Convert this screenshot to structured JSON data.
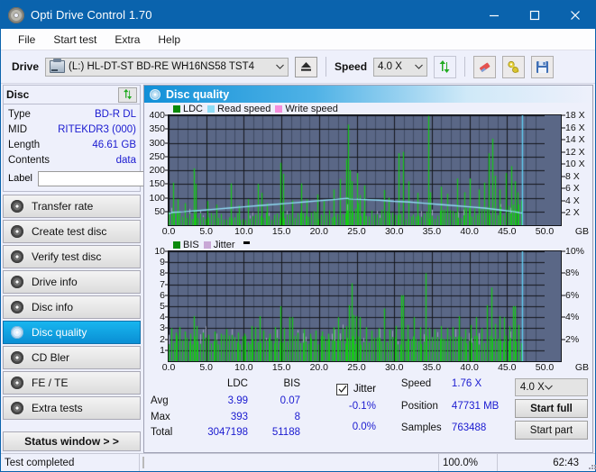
{
  "window": {
    "title": "Opti Drive Control 1.70",
    "icon": "disc-icon",
    "minimize": "minimize-icon",
    "maximize": "maximize-icon",
    "close": "close-icon"
  },
  "menu": {
    "items": [
      {
        "label": "File"
      },
      {
        "label": "Start test"
      },
      {
        "label": "Extra"
      },
      {
        "label": "Help"
      }
    ]
  },
  "toolbar": {
    "drive_label": "Drive",
    "drive_value": "(L:)  HL-DT-ST BD-RE  WH16NS58 TST4",
    "eject": "eject-icon",
    "speed_label": "Speed",
    "speed_value": "4.0 X",
    "refresh": "refresh-icon",
    "erase": "eraser-icon",
    "tools": "tools-icon",
    "save": "save-icon"
  },
  "sidebar": {
    "disc_panel": {
      "title": "Disc",
      "refresh_icon": "refresh-icon",
      "rows": [
        {
          "key": "Type",
          "value": "BD-R DL"
        },
        {
          "key": "MID",
          "value": "RITEKDR3 (000)"
        },
        {
          "key": "Length",
          "value": "46.61 GB"
        },
        {
          "key": "Contents",
          "value": "data"
        }
      ],
      "label_key": "Label",
      "label_value": "",
      "label_placeholder": "",
      "label_button_icon": "disc-icon"
    },
    "nav": [
      {
        "label": "Transfer rate",
        "active": false
      },
      {
        "label": "Create test disc",
        "active": false
      },
      {
        "label": "Verify test disc",
        "active": false
      },
      {
        "label": "Drive info",
        "active": false
      },
      {
        "label": "Disc info",
        "active": false
      },
      {
        "label": "Disc quality",
        "active": true
      },
      {
        "label": "CD Bler",
        "active": false
      },
      {
        "label": "FE / TE",
        "active": false
      },
      {
        "label": "Extra tests",
        "active": false
      }
    ],
    "status_window_button": "Status window > >"
  },
  "main": {
    "header_title": "Disc quality",
    "header_icon": "disc-quality-icon"
  },
  "stats": {
    "columns": [
      "LDC",
      "BIS"
    ],
    "rows": [
      {
        "label": "Avg",
        "ldc": "3.99",
        "bis": "0.07",
        "jitter": "-0.1%"
      },
      {
        "label": "Max",
        "ldc": "393",
        "bis": "8",
        "jitter": "0.0%"
      },
      {
        "label": "Total",
        "ldc": "3047198",
        "bis": "51188",
        "jitter": ""
      }
    ],
    "jitter_label": "Jitter",
    "jitter_checked": true,
    "speed_label": "Speed",
    "speed_value": "1.76 X",
    "position_label": "Position",
    "position_value": "47731 MB",
    "samples_label": "Samples",
    "samples_value": "763488",
    "speed_select": "4.0 X",
    "start_full_button": "Start full",
    "start_part_button": "Start part"
  },
  "statusbar": {
    "message": "Test completed",
    "progress_percent_label": "100.0%",
    "progress_value": 100,
    "elapsed": "62:43"
  },
  "colors": {
    "accent": "#0a63ad",
    "plot_bg": "#5a6786",
    "grid": "#14161c",
    "ldc_green": "#15cc15",
    "read_speed": "#8fdcf5",
    "write_speed": "#f58fdc",
    "bis_green": "#15cc15",
    "jitter": "#c9a8d6",
    "value_blue": "#1a1ad0",
    "progress_green": "#04c004",
    "nav_active": "#12a4e2"
  },
  "chart_data": [
    {
      "type": "line",
      "name": "ldc-read-speed-chart",
      "title": "",
      "xlabel": "GB",
      "ylabel": "LDC",
      "y2label": "Speed (X)",
      "xlim": [
        0,
        50
      ],
      "ylim": [
        0,
        400
      ],
      "y2lim": [
        0,
        18
      ],
      "grid": true,
      "legend": [
        {
          "label": "LDC",
          "color": "#0b8a0b"
        },
        {
          "label": "Read speed",
          "color": "#8fdcf5"
        },
        {
          "label": "Write speed",
          "color": "#f58fdc"
        }
      ],
      "xticks": [
        "0.0",
        "5.0",
        "10.0",
        "15.0",
        "20.0",
        "25.0",
        "30.0",
        "35.0",
        "40.0",
        "45.0",
        "50.0"
      ],
      "yticks": [
        400,
        350,
        300,
        250,
        200,
        150,
        100,
        50
      ],
      "y2ticks": [
        "18 X",
        "16 X",
        "14 X",
        "12 X",
        "10 X",
        "8 X",
        "6 X",
        "4 X",
        "2 X"
      ],
      "data_end_x": 47.0,
      "series": [
        {
          "name": "LDC",
          "color": "#15cc15",
          "type": "spikes",
          "baseline_profile": [
            [
              0.0,
              40
            ],
            [
              2.0,
              33
            ],
            [
              5.0,
              30
            ],
            [
              8.0,
              30
            ],
            [
              11.0,
              31
            ],
            [
              14.0,
              32
            ],
            [
              17.0,
              33
            ],
            [
              20.0,
              35
            ],
            [
              23.0,
              42
            ],
            [
              25.0,
              60
            ],
            [
              26.5,
              45
            ],
            [
              29.0,
              35
            ],
            [
              32.0,
              34
            ],
            [
              35.0,
              36
            ],
            [
              38.0,
              40
            ],
            [
              41.0,
              46
            ],
            [
              43.5,
              55
            ],
            [
              45.5,
              62
            ],
            [
              47.0,
              70
            ]
          ],
          "spikes": [
            [
              0.6,
              155
            ],
            [
              1.2,
              95
            ],
            [
              2.1,
              80
            ],
            [
              3.4,
              207
            ],
            [
              3.6,
              150
            ],
            [
              5.1,
              88
            ],
            [
              6.3,
              75
            ],
            [
              8.3,
              152
            ],
            [
              9.4,
              72
            ],
            [
              10.6,
              95
            ],
            [
              11.9,
              150
            ],
            [
              12.4,
              118
            ],
            [
              13.1,
              80
            ],
            [
              14.9,
              227
            ],
            [
              15.2,
              187
            ],
            [
              16.4,
              90
            ],
            [
              17.6,
              152
            ],
            [
              18.3,
              95
            ],
            [
              19.8,
              112
            ],
            [
              20.6,
              88
            ],
            [
              22.0,
              130
            ],
            [
              22.8,
              168
            ],
            [
              23.6,
              240
            ],
            [
              23.9,
              366
            ],
            [
              24.1,
              200
            ],
            [
              24.4,
              160
            ],
            [
              25.0,
              190
            ],
            [
              25.4,
              110
            ],
            [
              26.0,
              145
            ],
            [
              28.6,
              128
            ],
            [
              29.2,
              100
            ],
            [
              30.6,
              262
            ],
            [
              31.2,
              267
            ],
            [
              31.9,
              160
            ],
            [
              33.1,
              118
            ],
            [
              34.5,
              398
            ],
            [
              34.8,
              120
            ],
            [
              36.2,
              140
            ],
            [
              37.1,
              115
            ],
            [
              38.4,
              170
            ],
            [
              39.3,
              120
            ],
            [
              40.1,
              170
            ],
            [
              41.2,
              130
            ],
            [
              42.0,
              155
            ],
            [
              42.6,
              262
            ],
            [
              43.1,
              315
            ],
            [
              43.4,
              180
            ],
            [
              44.0,
              130
            ],
            [
              44.8,
              190
            ],
            [
              45.6,
              215
            ],
            [
              46.0,
              160
            ],
            [
              46.4,
              120
            ]
          ]
        },
        {
          "name": "Read speed",
          "color": "#8fdcf5",
          "type": "line",
          "points": [
            [
              0.0,
              1.9
            ],
            [
              0.5,
              2.1
            ],
            [
              2.0,
              2.2
            ],
            [
              4.0,
              2.4
            ],
            [
              6.0,
              2.6
            ],
            [
              8.0,
              2.8
            ],
            [
              10.0,
              3.0
            ],
            [
              12.0,
              3.2
            ],
            [
              14.0,
              3.4
            ],
            [
              16.0,
              3.6
            ],
            [
              18.0,
              3.8
            ],
            [
              20.0,
              4.0
            ],
            [
              22.0,
              4.2
            ],
            [
              23.8,
              4.4
            ],
            [
              24.0,
              4.3
            ],
            [
              26.0,
              4.2
            ],
            [
              28.0,
              4.1
            ],
            [
              30.0,
              3.9
            ],
            [
              32.0,
              3.8
            ],
            [
              34.0,
              3.6
            ],
            [
              36.0,
              3.4
            ],
            [
              38.0,
              3.2
            ],
            [
              40.0,
              3.0
            ],
            [
              42.0,
              2.8
            ],
            [
              44.0,
              2.5
            ],
            [
              46.0,
              2.2
            ],
            [
              47.0,
              2.0
            ]
          ]
        },
        {
          "name": "end-marker",
          "color": "#5fd0f5",
          "type": "vline",
          "x": 47.0
        }
      ]
    },
    {
      "type": "line",
      "name": "bis-jitter-chart",
      "title": "",
      "xlabel": "GB",
      "ylabel": "BIS",
      "y2label": "Jitter (%)",
      "xlim": [
        0,
        50
      ],
      "ylim": [
        0,
        10
      ],
      "y2lim": [
        0,
        10
      ],
      "grid": true,
      "legend": [
        {
          "label": "BIS",
          "color": "#0b8a0b"
        },
        {
          "label": "Jitter",
          "color": "#c9a8d6"
        }
      ],
      "xticks": [
        "0.0",
        "5.0",
        "10.0",
        "15.0",
        "20.0",
        "25.0",
        "30.0",
        "35.0",
        "40.0",
        "45.0",
        "50.0"
      ],
      "yticks": [
        10,
        9,
        8,
        7,
        6,
        5,
        4,
        3,
        2,
        1
      ],
      "y2ticks": [
        "10%",
        "8%",
        "6%",
        "4%",
        "2%"
      ],
      "data_end_x": 47.0,
      "series": [
        {
          "name": "BIS",
          "color": "#15cc15",
          "type": "spikes",
          "baseline": 1.9,
          "spikes": [
            [
              0.3,
              3.0
            ],
            [
              0.9,
              2.6
            ],
            [
              1.4,
              3.1
            ],
            [
              2.2,
              2.7
            ],
            [
              2.9,
              2.5
            ],
            [
              3.4,
              4.1
            ],
            [
              3.7,
              3.2
            ],
            [
              4.6,
              2.6
            ],
            [
              5.3,
              2.4
            ],
            [
              6.1,
              2.7
            ],
            [
              6.9,
              2.5
            ],
            [
              7.7,
              2.9
            ],
            [
              8.4,
              2.4
            ],
            [
              9.2,
              2.6
            ],
            [
              10.1,
              2.5
            ],
            [
              11.0,
              3.2
            ],
            [
              11.5,
              3.1
            ],
            [
              12.1,
              4.1
            ],
            [
              12.6,
              2.8
            ],
            [
              13.4,
              2.5
            ],
            [
              14.2,
              3.1
            ],
            [
              14.9,
              5.0
            ],
            [
              15.3,
              3.0
            ],
            [
              16.1,
              4.0
            ],
            [
              16.4,
              4.0
            ],
            [
              17.2,
              2.6
            ],
            [
              18.0,
              2.9
            ],
            [
              18.8,
              2.5
            ],
            [
              19.6,
              2.8
            ],
            [
              20.4,
              2.7
            ],
            [
              21.2,
              2.5
            ],
            [
              22.0,
              3.1
            ],
            [
              22.6,
              4.0
            ],
            [
              23.1,
              3.0
            ],
            [
              23.6,
              3.2
            ],
            [
              24.0,
              5.1
            ],
            [
              24.3,
              7.1
            ],
            [
              24.6,
              4.2
            ],
            [
              24.9,
              4.1
            ],
            [
              25.4,
              4.0
            ],
            [
              26.2,
              3.1
            ],
            [
              27.0,
              2.8
            ],
            [
              27.9,
              3.0
            ],
            [
              28.6,
              4.8
            ],
            [
              29.4,
              2.9
            ],
            [
              30.2,
              3.2
            ],
            [
              30.9,
              6.0
            ],
            [
              31.2,
              6.0
            ],
            [
              31.8,
              3.3
            ],
            [
              32.6,
              4.0
            ],
            [
              33.4,
              3.1
            ],
            [
              34.2,
              8.0
            ],
            [
              34.6,
              3.0
            ],
            [
              35.4,
              2.9
            ],
            [
              36.2,
              3.2
            ],
            [
              37.0,
              3.0
            ],
            [
              37.8,
              3.1
            ],
            [
              38.6,
              4.1
            ],
            [
              39.4,
              2.9
            ],
            [
              40.2,
              3.3
            ],
            [
              40.9,
              4.0
            ],
            [
              41.6,
              3.0
            ],
            [
              42.3,
              5.1
            ],
            [
              42.9,
              6.7
            ],
            [
              43.4,
              3.4
            ],
            [
              44.0,
              4.1
            ],
            [
              44.6,
              4.0
            ],
            [
              45.3,
              3.2
            ],
            [
              45.8,
              5.0
            ],
            [
              46.1,
              5.0
            ],
            [
              46.5,
              3.3
            ]
          ]
        },
        {
          "name": "Jitter",
          "color": "#c9a8d6",
          "type": "spikes-overlay"
        },
        {
          "name": "end-marker",
          "color": "#5fd0f5",
          "type": "vline",
          "x": 47.0
        }
      ]
    }
  ]
}
